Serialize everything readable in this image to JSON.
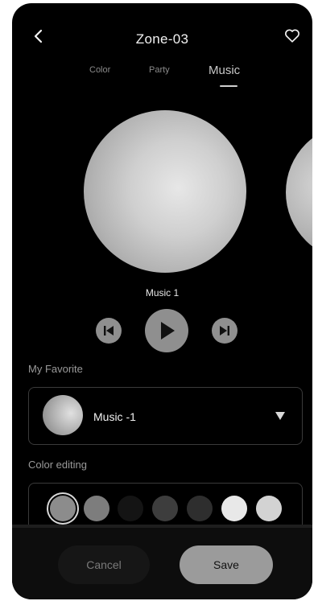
{
  "header": {
    "title": "Zone-03",
    "back_icon": "chevron-left-icon",
    "favorite_icon": "heart-outline-icon"
  },
  "tabs": [
    {
      "label": "Color",
      "active": false
    },
    {
      "label": "Party",
      "active": false
    },
    {
      "label": "Music",
      "active": true
    }
  ],
  "player": {
    "track_name": "Music 1",
    "prev_icon": "skip-previous-icon",
    "play_icon": "play-icon",
    "next_icon": "skip-next-icon"
  },
  "favorite": {
    "label": "My Favorite",
    "selected": "Music -1",
    "dropdown_icon": "caret-down-icon"
  },
  "color_editing": {
    "label": "Color editing",
    "swatches": [
      "#8c8c8c",
      "#7d7d7d",
      "#141414",
      "#3d3d3d",
      "#2e2e2e",
      "#e8e8e8",
      "#d3d3d3"
    ],
    "selected_index": 0
  },
  "actions": {
    "cancel_label": "Cancel",
    "save_label": "Save"
  }
}
